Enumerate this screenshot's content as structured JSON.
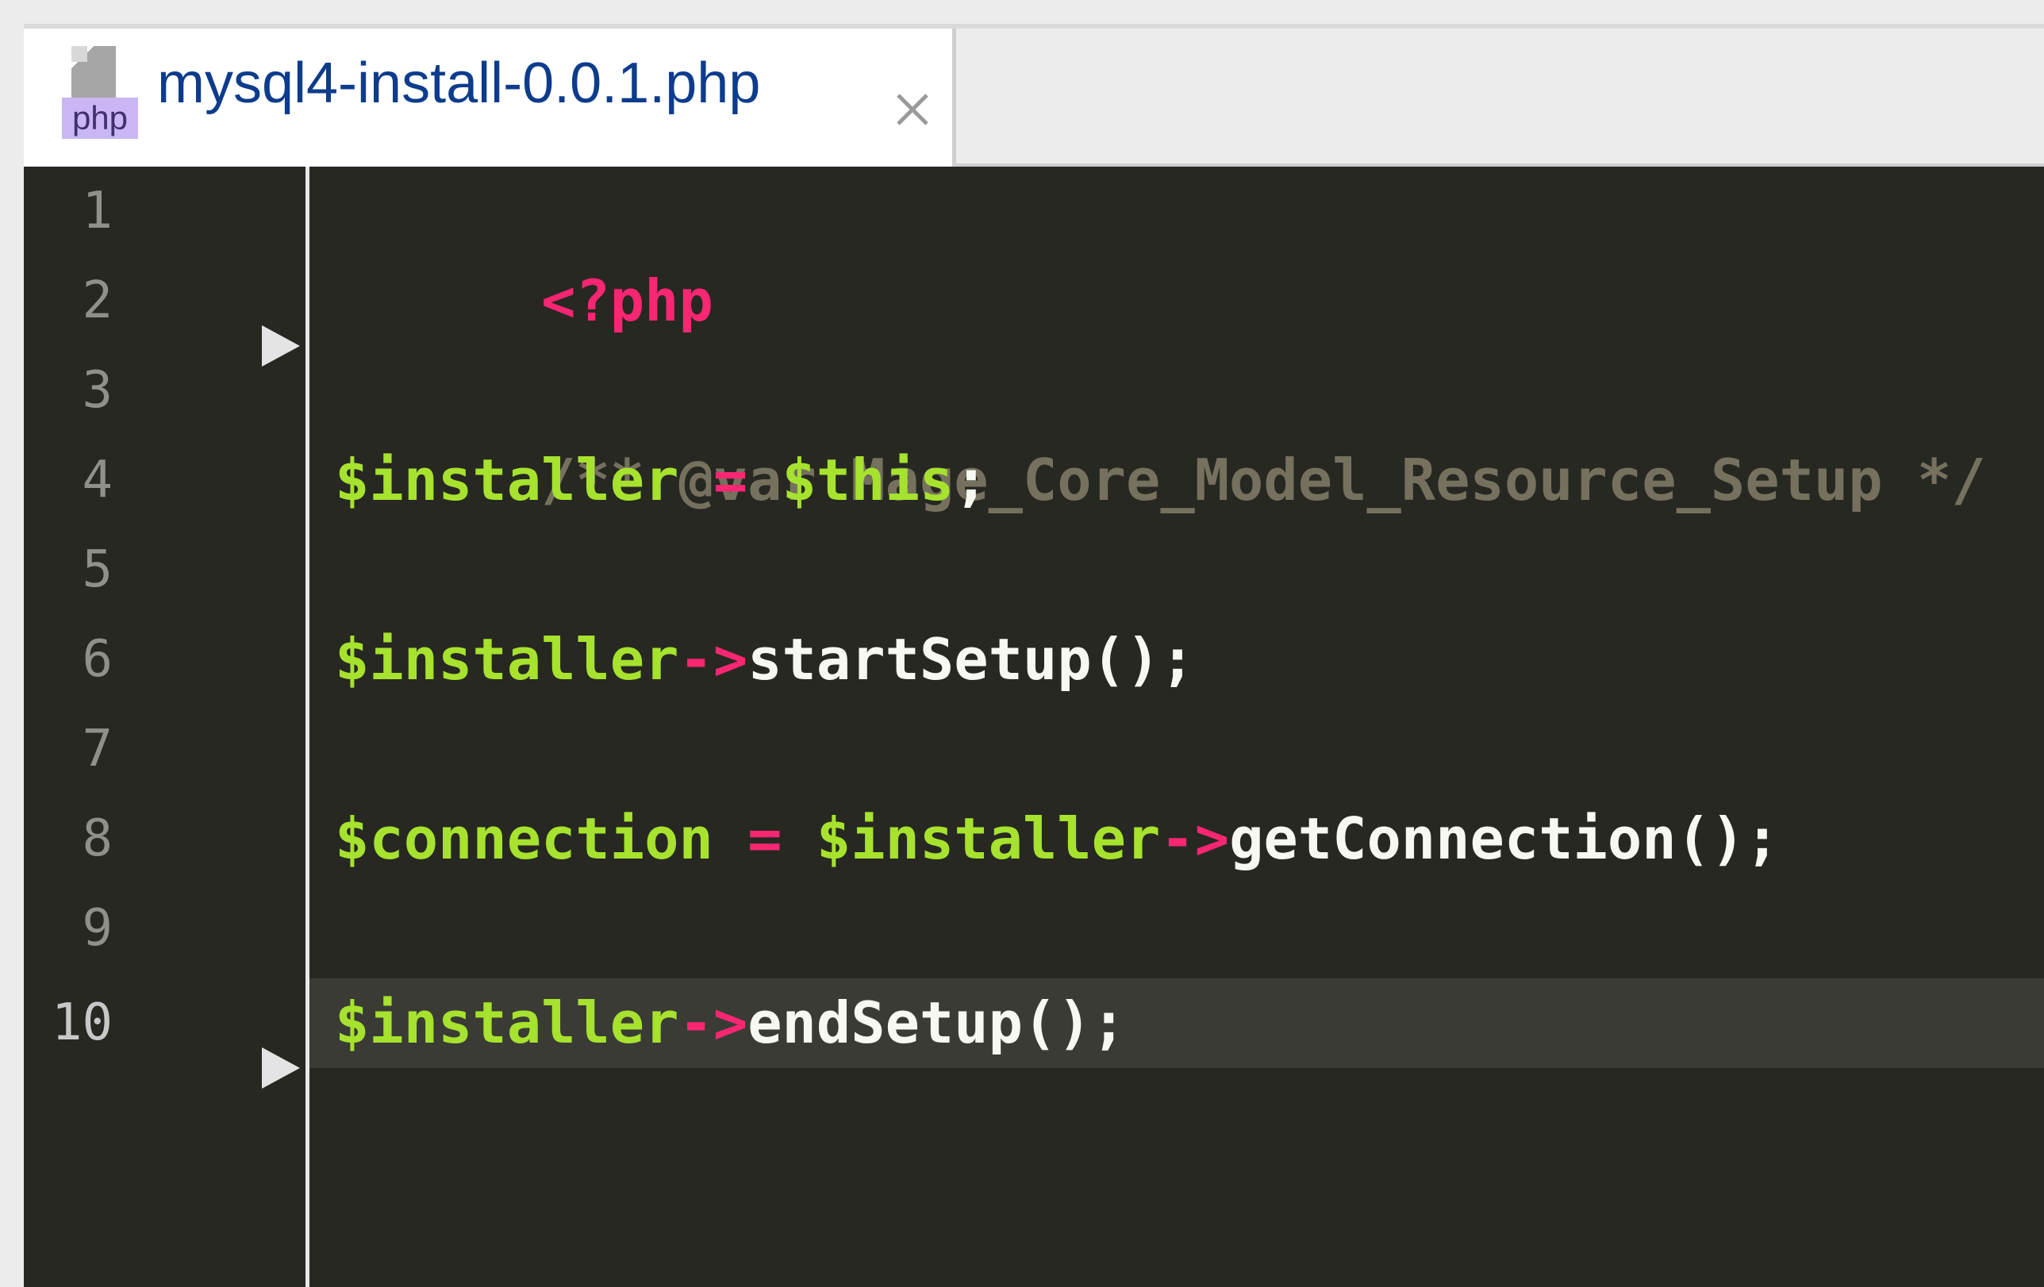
{
  "tab": {
    "title": "mysql4-install-0.0.1.php",
    "icon_label": "php",
    "close_glyph": "×"
  },
  "editor": {
    "line_numbers": [
      "1",
      "2",
      "3",
      "4",
      "5",
      "6",
      "7",
      "8",
      "9",
      "10"
    ],
    "current_line": "10",
    "lines": {
      "l1": {
        "open_tag": "<?php"
      },
      "l3": {
        "comment": "/** @var Mage_Core_Model_Resource_Setup */"
      },
      "l4": {
        "var1": "$installer",
        "op": " = ",
        "var2": "$this",
        "end": ";"
      },
      "l6": {
        "var": "$installer",
        "arrow": "->",
        "call": "startSetup();"
      },
      "l8": {
        "var1": "$connection",
        "op": " = ",
        "var2": "$installer",
        "arrow": "->",
        "call": "getConnection();"
      },
      "l10": {
        "var": "$installer",
        "arrow": "->",
        "call": "endSetup();"
      }
    }
  },
  "colors": {
    "background": "#272822",
    "keyword": "#f92672",
    "variable": "#a6e22e",
    "comment": "#75715e",
    "text": "#f8f8f2",
    "tab_title": "#0e3c8c"
  }
}
